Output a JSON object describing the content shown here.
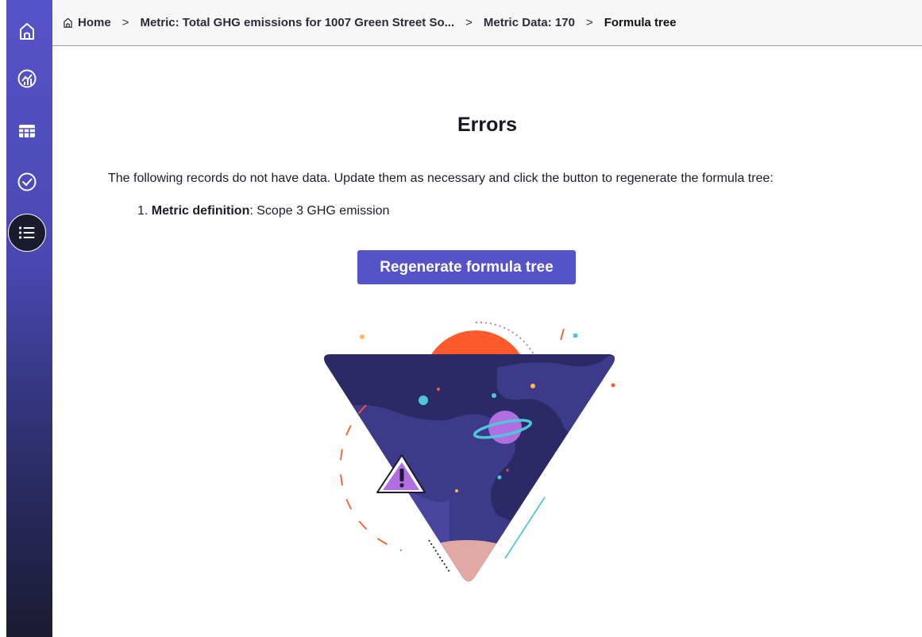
{
  "breadcrumb": {
    "items": [
      {
        "label": "Home"
      },
      {
        "label": "Metric: Total GHG emissions for 1007 Green Street So..."
      },
      {
        "label": "Metric Data: 170"
      },
      {
        "label": "Formula tree"
      }
    ],
    "separator": ">"
  },
  "sidebar": {
    "items": [
      {
        "icon": "home-icon"
      },
      {
        "icon": "dashboard-icon"
      },
      {
        "icon": "table-icon"
      },
      {
        "icon": "check-circle-icon"
      },
      {
        "icon": "list-icon",
        "active": true
      }
    ]
  },
  "main": {
    "title": "Errors",
    "description": "The following records do not have data. Update them as necessary and click the button to regenerate the formula tree:",
    "errors": [
      {
        "number": "1.",
        "label": "Metric definition",
        "separator": ":",
        "value": " Scope 3 GHG emission"
      }
    ],
    "button_label": "Regenerate formula tree"
  },
  "colors": {
    "accent": "#5553c8",
    "sidebar_dark": "#1b1b33",
    "illustration_navy": "#2b2a66",
    "illustration_purple": "#3d3a8a",
    "planet": "#b06ee0",
    "sun": "#ff5a2e"
  }
}
